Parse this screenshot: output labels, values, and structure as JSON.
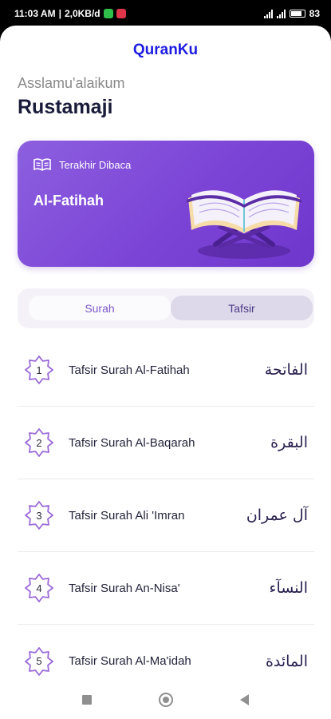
{
  "status_bar": {
    "time": "11:03 AM",
    "speed": "2,0KB/d",
    "battery": "83"
  },
  "app": {
    "title": "QuranKu"
  },
  "greeting": "Asslamu'alaikum",
  "user_name": "Rustamaji",
  "last_read": {
    "label": "Terakhir Dibaca",
    "surah": "Al-Fatihah"
  },
  "tabs": [
    {
      "label": "Surah",
      "active": false
    },
    {
      "label": "Tafsir",
      "active": true
    }
  ],
  "items": [
    {
      "number": "1",
      "title": "Tafsir Surah Al-Fatihah",
      "arabic": "الفاتحة"
    },
    {
      "number": "2",
      "title": "Tafsir Surah Al-Baqarah",
      "arabic": "البقرة"
    },
    {
      "number": "3",
      "title": "Tafsir Surah Ali 'Imran",
      "arabic": "آل عمران"
    },
    {
      "number": "4",
      "title": "Tafsir Surah An-Nisa'",
      "arabic": "النسآء"
    },
    {
      "number": "5",
      "title": "Tafsir Surah Al-Ma'idah",
      "arabic": "المائدة"
    }
  ],
  "colors": {
    "accent": "#7c44d6",
    "title": "#1d1be0"
  }
}
